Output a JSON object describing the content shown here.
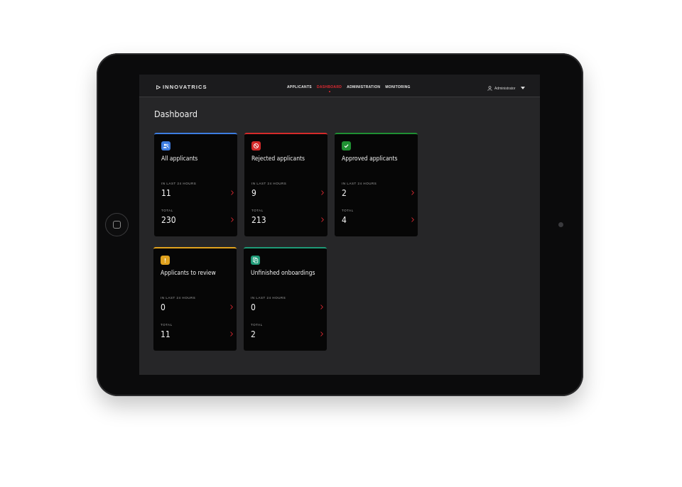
{
  "app": {
    "brand": "INNOVATRICS",
    "accent_color": "#e02a32"
  },
  "nav": {
    "tabs": [
      {
        "label": "APPLICANTS",
        "active": false
      },
      {
        "label": "DASHBOARD",
        "active": true
      },
      {
        "label": "ADMINISTRATION",
        "active": false
      },
      {
        "label": "MONITORING",
        "active": false
      }
    ]
  },
  "user": {
    "name": "Administrator",
    "icon": "user-icon",
    "menu_icon": "caret-down-icon"
  },
  "page": {
    "title": "Dashboard"
  },
  "cards": [
    {
      "title": "All applicants",
      "icon": "users-icon",
      "color": "#3d7ce0",
      "recent_label": "IN LAST 24 HOURS",
      "recent_value": "11",
      "total_label": "TOTAL",
      "total_value": "230"
    },
    {
      "title": "Rejected applicants",
      "icon": "ban-icon",
      "color": "#d42a2a",
      "recent_label": "IN LAST 24 HOURS",
      "recent_value": "9",
      "total_label": "TOTAL",
      "total_value": "213"
    },
    {
      "title": "Approved applicants",
      "icon": "check-icon",
      "color": "#1f8f32",
      "recent_label": "IN LAST 24 HOURS",
      "recent_value": "2",
      "total_label": "TOTAL",
      "total_value": "4"
    },
    {
      "title": "Applicants to review",
      "icon": "exclamation-icon",
      "color": "#e0a21e",
      "recent_label": "IN LAST 24 HOURS",
      "recent_value": "0",
      "total_label": "TOTAL",
      "total_value": "11"
    },
    {
      "title": "Unfinished onboardings",
      "icon": "documents-icon",
      "color": "#1e9a77",
      "recent_label": "IN LAST 24 HOURS",
      "recent_value": "0",
      "total_label": "TOTAL",
      "total_value": "2"
    }
  ]
}
